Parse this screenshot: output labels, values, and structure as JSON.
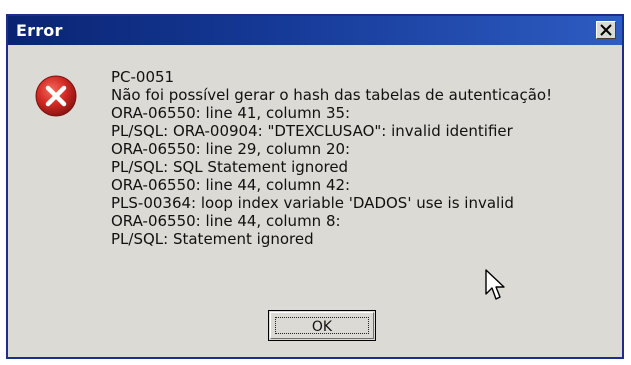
{
  "window": {
    "title": "Error",
    "close_icon": "close-icon"
  },
  "icon": {
    "name": "error-icon",
    "color": "#d32a25"
  },
  "message": {
    "lines": [
      "PC-0051",
      "Não foi possível gerar o hash das tabelas de autenticação!",
      "ORA-06550: line 41, column 35:",
      "PL/SQL: ORA-00904: \"DTEXCLUSAO\": invalid identifier",
      "ORA-06550: line 29, column 20:",
      "PL/SQL: SQL Statement ignored",
      "ORA-06550: line 44, column 42:",
      "PLS-00364: loop index variable 'DADOS' use is invalid",
      "ORA-06550: line 44, column 8:",
      "PL/SQL: Statement ignored"
    ]
  },
  "buttons": {
    "ok_label": "OK"
  },
  "colors": {
    "titlebar_start": "#0a2473",
    "titlebar_end": "#2e5cc2",
    "dialog_bg": "#dcdad4"
  }
}
